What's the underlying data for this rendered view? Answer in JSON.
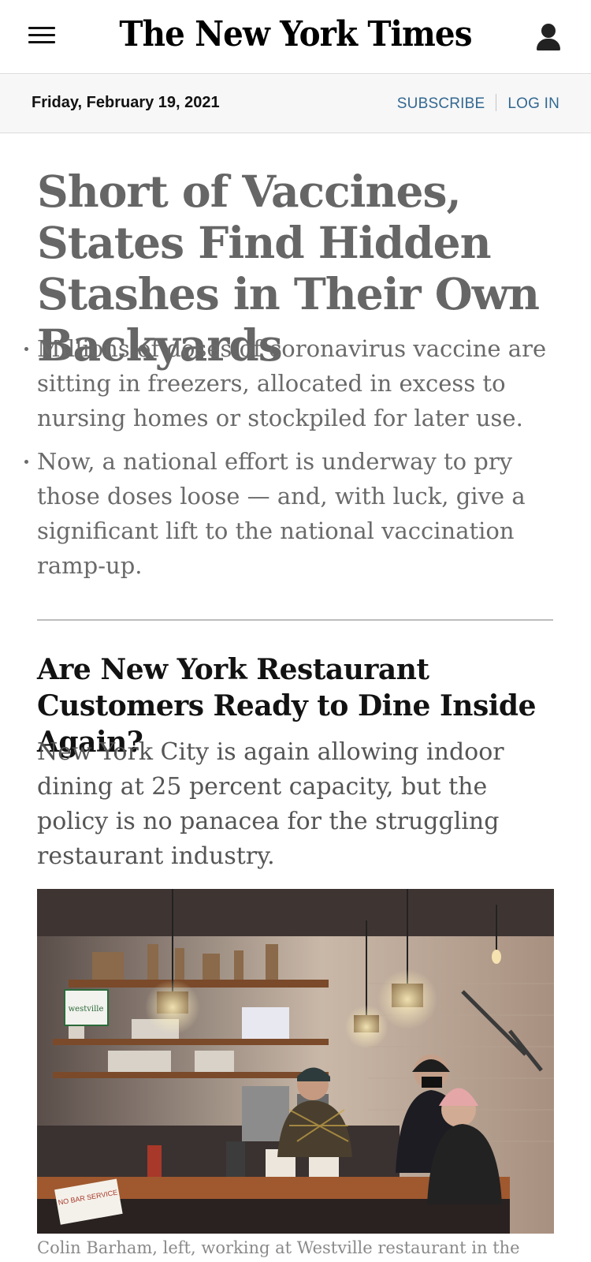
{
  "header": {
    "logo_text": "The New York Times",
    "menu_icon": "hamburger-menu-icon",
    "account_icon": "user-account-icon"
  },
  "datebar": {
    "date": "Friday, February 19, 2021",
    "subscribe_label": "SUBSCRIBE",
    "login_label": "LOG IN",
    "link_color": "#326891"
  },
  "lead_story": {
    "headline": "Short of Vaccines, States Find Hidden Stashes in Their Own Backyards",
    "bullets": [
      "Millions of doses of coronavirus vaccine are sitting in freezers, allocated in excess to nursing homes or stockpiled for later use.",
      "Now, a national effort is underway to pry those doses loose — and, with luck, give a significant lift to the national vaccination ramp-up."
    ]
  },
  "story2": {
    "headline": "Are New York Restaurant Customers Ready to Dine Inside Again?",
    "summary": "New York City is again allowing indoor dining at 25 percent capacity, but the policy is no panacea for the struggling restaurant industry.",
    "photo_caption": "Colin Barham, left, working at Westville restaurant in the",
    "photo_sign_text": "westville",
    "photo_counter_sign": "NO BAR SERVICE"
  }
}
